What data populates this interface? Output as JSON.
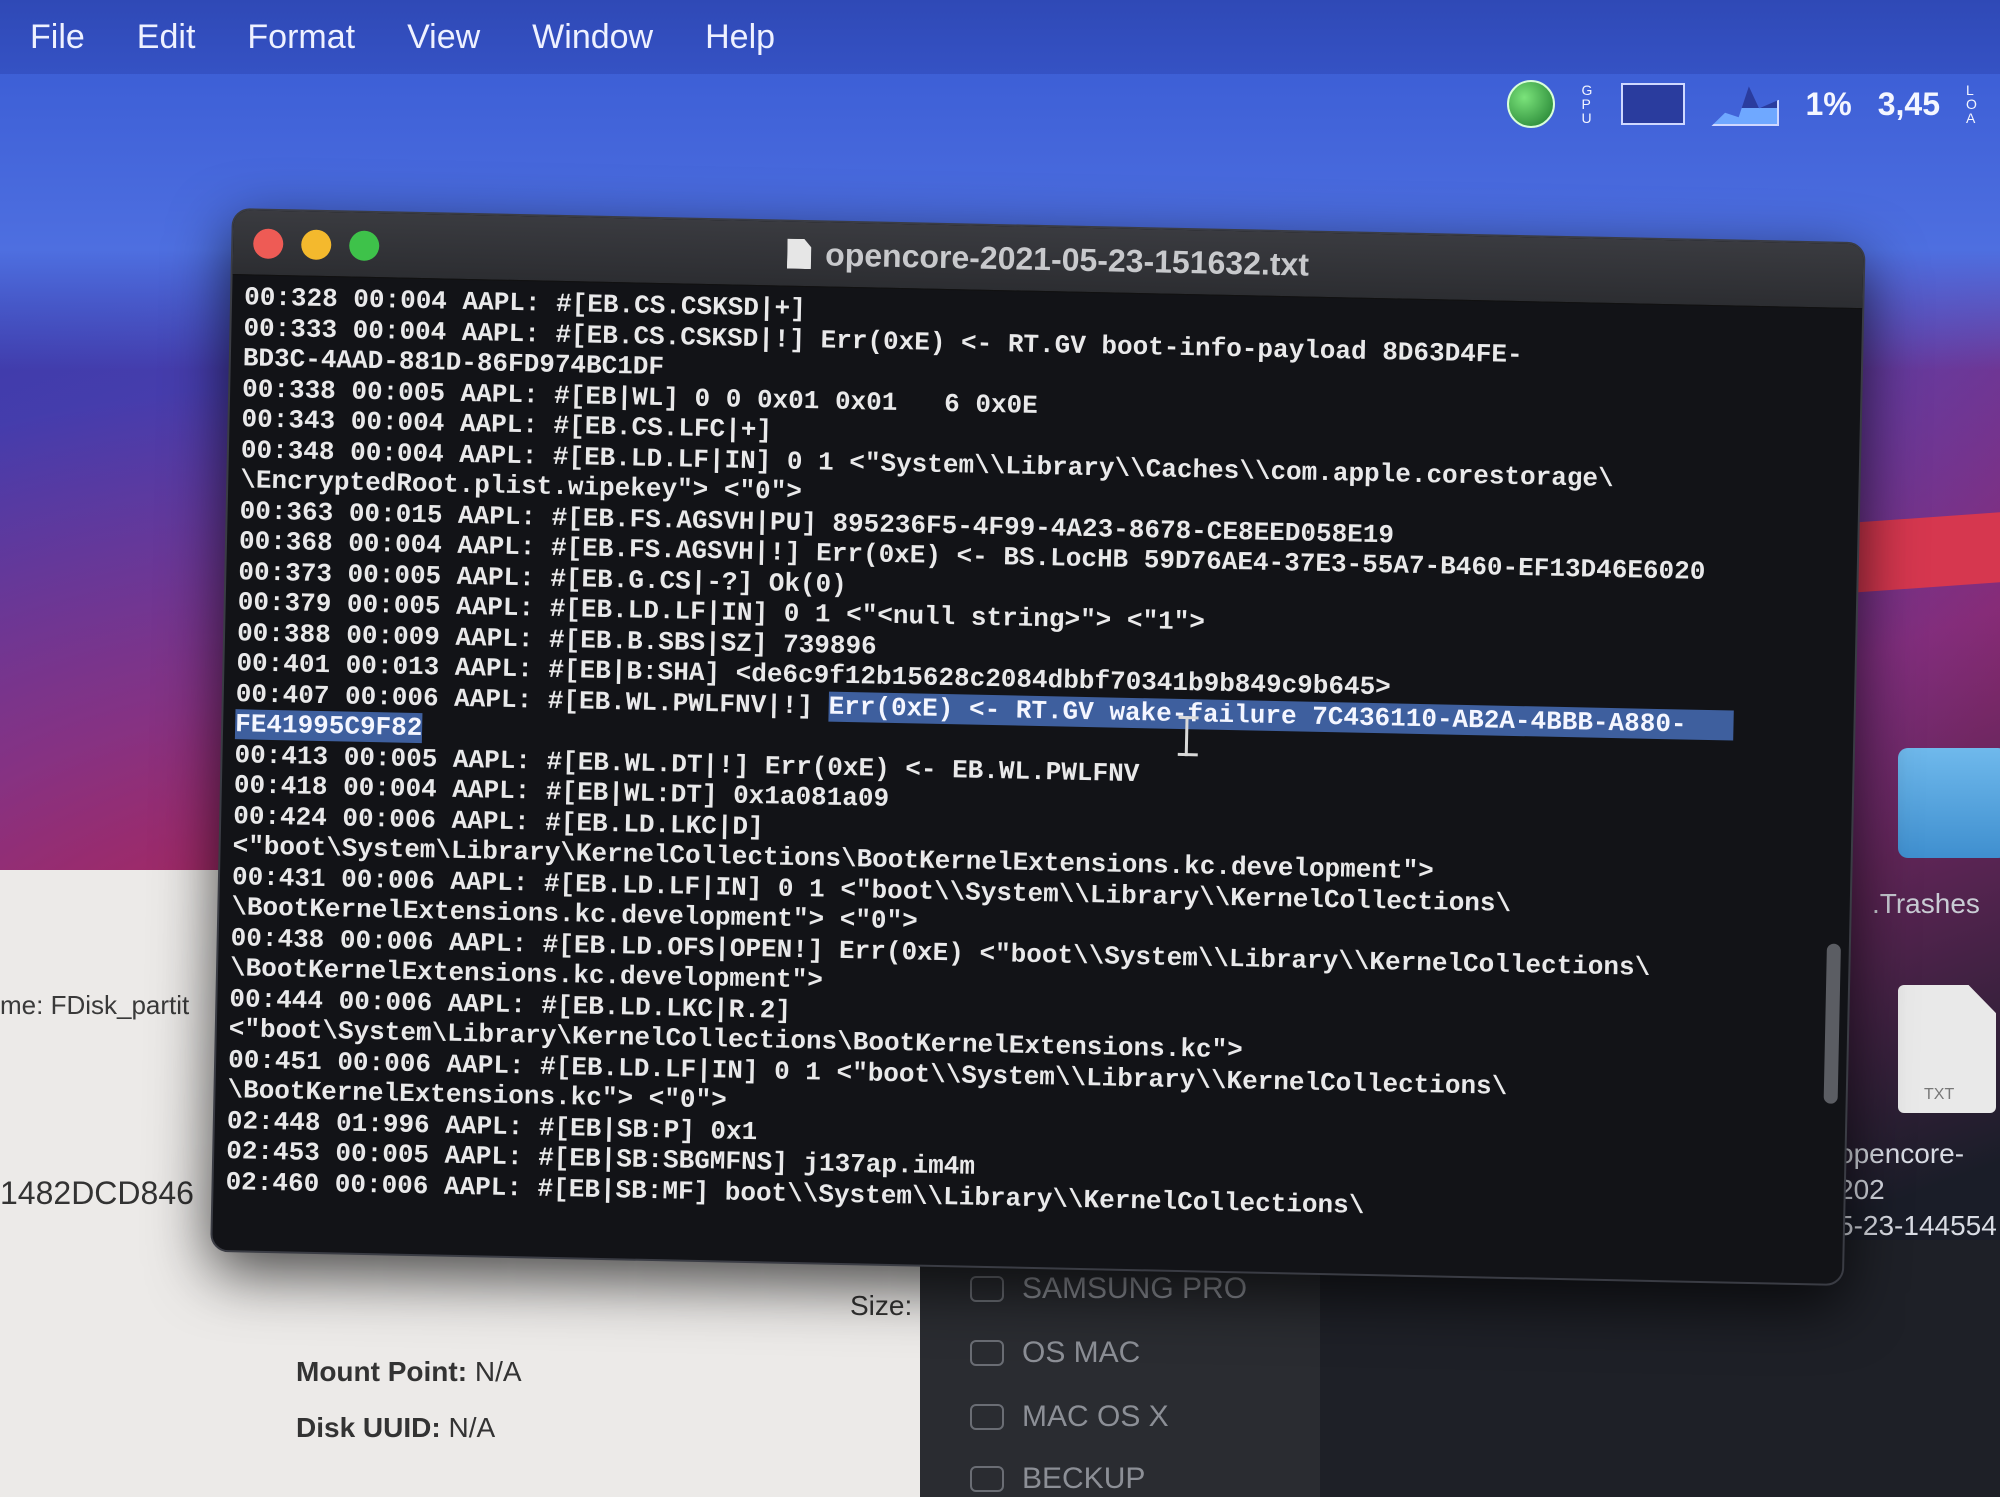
{
  "menubar": {
    "items": [
      "File",
      "Edit",
      "Format",
      "View",
      "Window",
      "Help"
    ]
  },
  "status": {
    "cpu_percent": "1%",
    "load": "3,45",
    "gpu_label": "GPU",
    "load_label": "LOA"
  },
  "window": {
    "title": "opencore-2021-05-23-151632.txt"
  },
  "log_lines": [
    {
      "text": "00:328 00:004 AAPL: #[EB.CS.CSKSD|+]"
    },
    {
      "text": "00:333 00:004 AAPL: #[EB.CS.CSKSD|!] Err(0xE) <- RT.GV boot-info-payload 8D63D4FE-"
    },
    {
      "text": "BD3C-4AAD-881D-86FD974BC1DF"
    },
    {
      "text": "00:338 00:005 AAPL: #[EB|WL] 0 0 0x01 0x01   6 0x0E"
    },
    {
      "text": "00:343 00:004 AAPL: #[EB.CS.LFC|+]"
    },
    {
      "text": "00:348 00:004 AAPL: #[EB.LD.LF|IN] 0 1 <\"System\\\\Library\\\\Caches\\\\com.apple.corestorage\\"
    },
    {
      "text": "\\EncryptedRoot.plist.wipekey\"> <\"0\">"
    },
    {
      "text": "00:363 00:015 AAPL: #[EB.FS.AGSVH|PU] 895236F5-4F99-4A23-8678-CE8EED058E19"
    },
    {
      "text": "00:368 00:004 AAPL: #[EB.FS.AGSVH|!] Err(0xE) <- BS.LocHB 59D76AE4-37E3-55A7-B460-EF13D46E6020"
    },
    {
      "text": "00:373 00:005 AAPL: #[EB.G.CS|-?] Ok(0)"
    },
    {
      "text": "00:379 00:005 AAPL: #[EB.LD.LF|IN] 0 1 <\"<null string>\"> <\"1\">"
    },
    {
      "text": "00:388 00:009 AAPL: #[EB.B.SBS|SZ] 739896"
    },
    {
      "text": "00:401 00:013 AAPL: #[EB|B:SHA] <de6c9f12b15628c2084dbbf70341b9b849c9b645>"
    },
    {
      "text": "00:407 00:006 AAPL: #[EB.WL.PWLFNV|!] ",
      "highlight": "Err(0xE) <- RT.GV wake-failure 7C436110-AB2A-4BBB-A880-   "
    },
    {
      "text": "",
      "highlight": "FE41995C9F82"
    },
    {
      "text": "00:413 00:005 AAPL: #[EB.WL.DT|!] Err(0xE) <- EB.WL.PWLFNV"
    },
    {
      "text": "00:418 00:004 AAPL: #[EB|WL:DT] 0x1a081a09"
    },
    {
      "text": "00:424 00:006 AAPL: #[EB.LD.LKC|D]"
    },
    {
      "text": "<\"boot\\System\\Library\\KernelCollections\\BootKernelExtensions.kc.development\">"
    },
    {
      "text": "00:431 00:006 AAPL: #[EB.LD.LF|IN] 0 1 <\"boot\\\\System\\\\Library\\\\KernelCollections\\"
    },
    {
      "text": "\\BootKernelExtensions.kc.development\"> <\"0\">"
    },
    {
      "text": "00:438 00:006 AAPL: #[EB.LD.OFS|OPEN!] Err(0xE) <\"boot\\\\System\\\\Library\\\\KernelCollections\\"
    },
    {
      "text": "\\BootKernelExtensions.kc.development\">"
    },
    {
      "text": "00:444 00:006 AAPL: #[EB.LD.LKC|R.2]"
    },
    {
      "text": "<\"boot\\System\\Library\\KernelCollections\\BootKernelExtensions.kc\">"
    },
    {
      "text": "00:451 00:006 AAPL: #[EB.LD.LF|IN] 0 1 <\"boot\\\\System\\\\Library\\\\KernelCollections\\"
    },
    {
      "text": "\\BootKernelExtensions.kc\"> <\"0\">"
    },
    {
      "text": "02:448 01:996 AAPL: #[EB|SB:P] 0x1"
    },
    {
      "text": "02:453 00:005 AAPL: #[EB|SB:SBGMFNS] j137ap.im4m"
    },
    {
      "text": "02:460 00:006 AAPL: #[EB|SB:MF] boot\\\\System\\\\Library\\\\KernelCollections\\"
    }
  ],
  "background_app": {
    "name_label": "me: FDisk_partit",
    "uuid_fragment": "1482DCD846",
    "size_label": "Size:",
    "mount_point_label": "Mount Point:",
    "mount_point_value": "N/A",
    "disk_uuid_label": "Disk UUID:",
    "disk_uuid_value": "N/A",
    "disks": [
      "SAMSUNG PRO",
      "OS MAC",
      "MAC OS X",
      "BECKUP"
    ]
  },
  "desktop": {
    "folder_label": ".Trashes",
    "file_ext": "TXT",
    "file_label_line1": "opencore-202",
    "file_label_line2": "5-23-144554"
  }
}
